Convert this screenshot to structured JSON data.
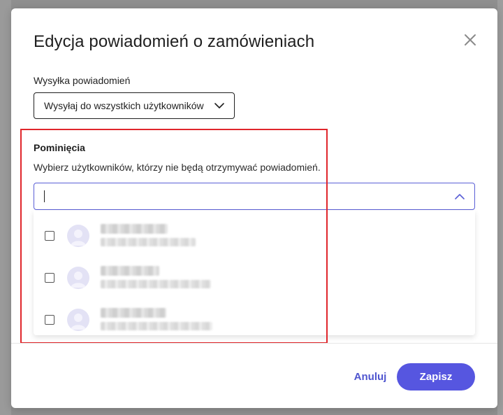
{
  "modal": {
    "title": "Edycja powiadomień o zamówieniach",
    "close_icon": "close-icon"
  },
  "notification_sending": {
    "label": "Wysyłka powiadomień",
    "selected_value": "Wysyłaj do wszystkich użytkowników",
    "icon": "chevron-down-icon"
  },
  "exclusions": {
    "title": "Pominięcia",
    "description": "Wybierz użytkowników, którzy nie będą otrzymywać powiadomień.",
    "search_value": "",
    "toggle_icon": "chevron-up-icon",
    "users": [
      {
        "checked": false,
        "avatar_icon": "user-avatar-icon"
      },
      {
        "checked": false,
        "avatar_icon": "user-avatar-icon"
      },
      {
        "checked": false,
        "avatar_icon": "user-avatar-icon"
      }
    ]
  },
  "footer": {
    "cancel_label": "Anuluj",
    "save_label": "Zapisz"
  },
  "colors": {
    "accent": "#5656e0",
    "link": "#4f55cf",
    "highlight": "#e0262b",
    "focus_border": "#5a5fd6"
  }
}
